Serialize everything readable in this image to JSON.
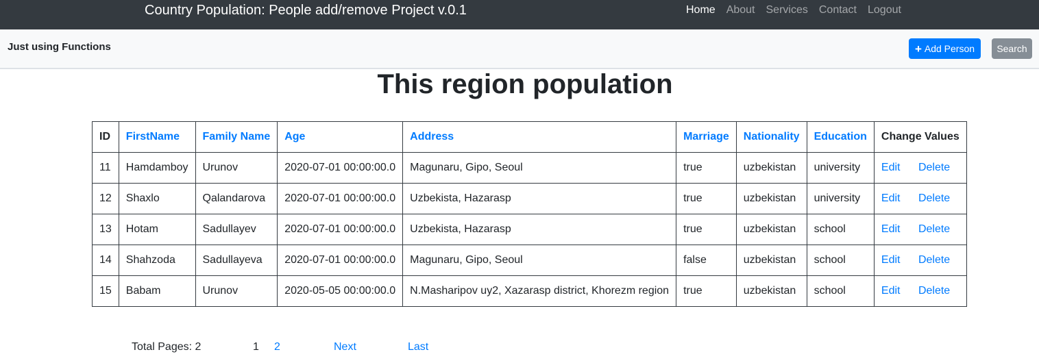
{
  "header": {
    "brand": "Country Population: People add/remove Project v.0.1",
    "nav": [
      {
        "label": "Home",
        "active": true
      },
      {
        "label": "About",
        "active": false
      },
      {
        "label": "Services",
        "active": false
      },
      {
        "label": "Contact",
        "active": false
      },
      {
        "label": "Logout",
        "active": false
      }
    ]
  },
  "toolbar": {
    "subtitle": "Just using Functions",
    "add_icon": "plus-icon",
    "add_label": "Add Person",
    "search_label": "Search"
  },
  "main": {
    "title": "This region population"
  },
  "table": {
    "columns": [
      "ID",
      "FirstName",
      "Family Name",
      "Age",
      "Address",
      "Marriage",
      "Nationality",
      "Education",
      "Change Values"
    ],
    "sortable_columns": [
      "FirstName",
      "Family Name",
      "Age",
      "Address",
      "Marriage",
      "Nationality",
      "Education"
    ],
    "rows": [
      {
        "id": "11",
        "first_name": "Hamdamboy",
        "family_name": "Urunov",
        "age": "2020-07-01 00:00:00.0",
        "address": "Magunaru, Gipo, Seoul",
        "marriage": "true",
        "nationality": "uzbekistan",
        "education": "university",
        "edit": "Edit",
        "delete": "Delete"
      },
      {
        "id": "12",
        "first_name": "Shaxlo",
        "family_name": "Qalandarova",
        "age": "2020-07-01 00:00:00.0",
        "address": "Uzbekista, Hazarasp",
        "marriage": "true",
        "nationality": "uzbekistan",
        "education": "university",
        "edit": "Edit",
        "delete": "Delete"
      },
      {
        "id": "13",
        "first_name": "Hotam",
        "family_name": "Sadullayev",
        "age": "2020-07-01 00:00:00.0",
        "address": "Uzbekista, Hazarasp",
        "marriage": "true",
        "nationality": "uzbekistan",
        "education": "school",
        "edit": "Edit",
        "delete": "Delete"
      },
      {
        "id": "14",
        "first_name": "Shahzoda",
        "family_name": "Sadullayeva",
        "age": "2020-07-01 00:00:00.0",
        "address": "Magunaru, Gipo, Seoul",
        "marriage": "false",
        "nationality": "uzbekistan",
        "education": "school",
        "edit": "Edit",
        "delete": "Delete"
      },
      {
        "id": "15",
        "first_name": "Babam",
        "family_name": "Urunov",
        "age": "2020-05-05 00:00:00.0",
        "address": "N.Masharipov uy2, Xazarasp district, Khorezm region",
        "marriage": "true",
        "nationality": "uzbekistan",
        "education": "school",
        "edit": "Edit",
        "delete": "Delete"
      }
    ]
  },
  "pagination": {
    "total_pages_label": "Total Pages: 2",
    "current_page": "1",
    "page_2": "2",
    "next_label": "Next",
    "last_label": "Last"
  },
  "colors": {
    "navbar_bg": "#343a40",
    "link": "#007bff",
    "add_button": "#007bff",
    "search_button": "#868e96"
  }
}
